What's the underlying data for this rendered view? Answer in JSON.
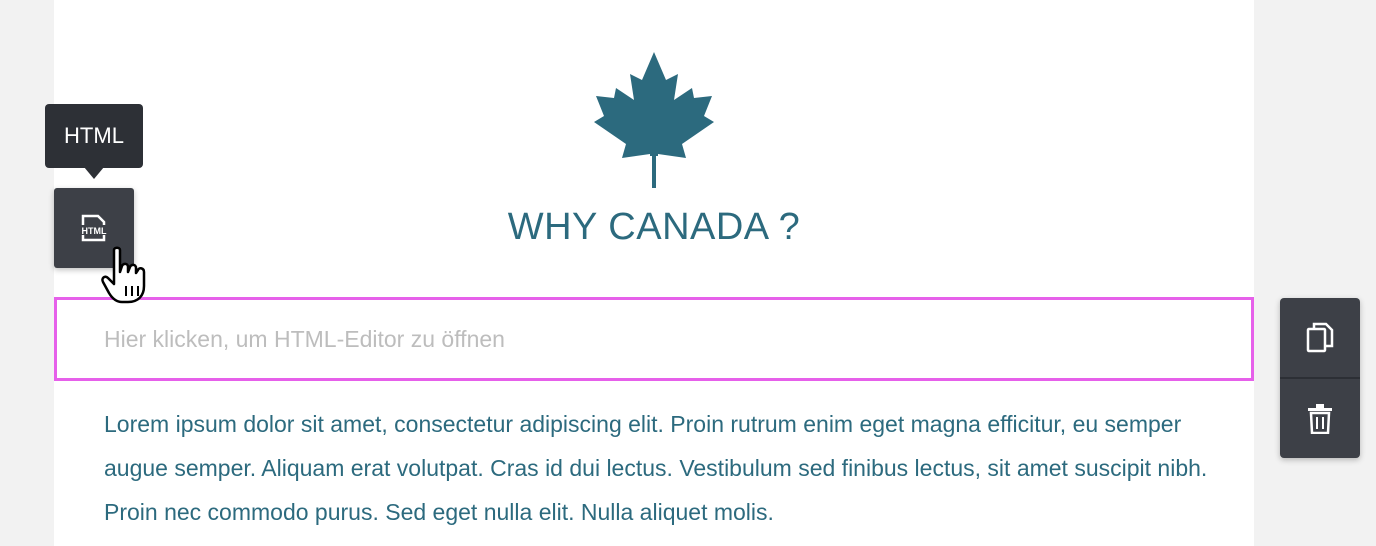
{
  "editor": {
    "heading": "WHY CANADA ?",
    "html_block_placeholder": "Hier klicken, um HTML-Editor zu öffnen",
    "paragraph": "Lorem ipsum dolor sit amet, consectetur adipiscing elit. Proin rutrum enim eget magna efficitur, eu semper augue semper. Aliquam erat volutpat. Cras id dui lectus. Vestibulum sed finibus lectus, sit amet suscipit nibh. Proin nec commodo purus. Sed eget nulla elit. Nulla aliquet molis."
  },
  "widget_tooltip": {
    "label": "HTML"
  },
  "widget_button": {
    "icon": "html-file-icon",
    "icon_text": "HTML"
  },
  "side_toolbar": {
    "icons": [
      "copy-icon",
      "trash-icon"
    ]
  },
  "colors": {
    "accent": "#2c6a7e",
    "selection_border": "#e660ea",
    "toolbar_bg": "#3d4047",
    "tooltip_bg": "#2d3036",
    "placeholder": "#bdbdbd"
  }
}
